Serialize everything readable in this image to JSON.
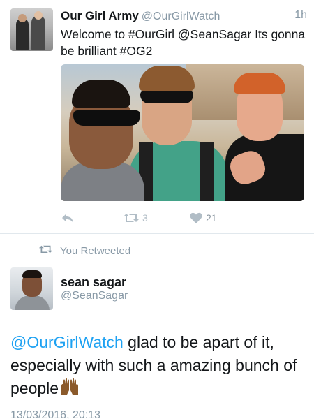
{
  "tweet1": {
    "name": "Our Girl Army",
    "handle": "@OurGirlWatch",
    "time": "1h",
    "text": "Welcome to #OurGirl @SeanSagar Its gonna be brilliant #OG2",
    "retweets": "3",
    "likes": "21"
  },
  "retweet_notice": "You Retweeted",
  "tweet2": {
    "name": "sean sagar",
    "handle": "@SeanSagar",
    "mention": "@OurGirlWatch",
    "text": " glad to be apart of it, especially with such a amazing bunch of people",
    "emoji": "raised-hands-emoji",
    "date": "13/03/2016, 20:13"
  },
  "colors": {
    "link": "#1da1f2",
    "secondary": "#8899a6",
    "action_icon": "#b1bdc6",
    "divider": "#e1e8ed"
  }
}
